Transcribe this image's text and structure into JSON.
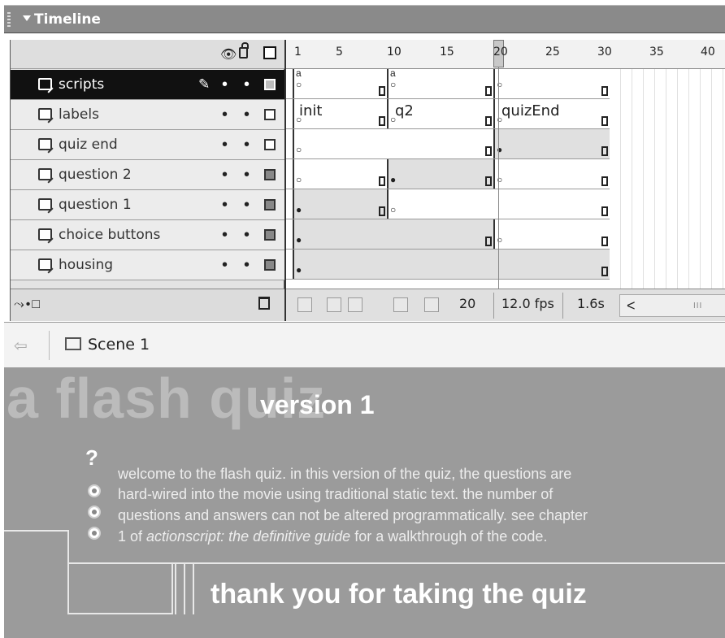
{
  "timeline": {
    "title": "Timeline",
    "header_eye_icon": "eye-icon",
    "header_lock_icon": "lock-icon",
    "header_outline_icon": "outline-icon",
    "ruler_ticks": [
      "1",
      "5",
      "10",
      "15",
      "20",
      "25",
      "30",
      "35",
      "40"
    ],
    "layers": [
      {
        "name": "scripts",
        "selected": true,
        "outline": "filled"
      },
      {
        "name": "labels",
        "selected": false,
        "outline": "empty"
      },
      {
        "name": "quiz end",
        "selected": false,
        "outline": "empty"
      },
      {
        "name": "question 2",
        "selected": false,
        "outline": "filled"
      },
      {
        "name": "question 1",
        "selected": false,
        "outline": "filled"
      },
      {
        "name": "choice buttons",
        "selected": false,
        "outline": "filled"
      },
      {
        "name": "housing",
        "selected": false,
        "outline": "filled"
      }
    ],
    "frame_labels": {
      "init": "init",
      "q2": "q2",
      "quizEnd": "quizEnd"
    },
    "action_marker": "a",
    "visibility_dot": "•",
    "footer": {
      "current_frame": "20",
      "fps": "12.0 fps",
      "elapsed": "1.6s",
      "scroll_left": "<",
      "scroll_thumb": "III"
    }
  },
  "scene_bar": {
    "back_icon": "back-arrow-icon",
    "scene_icon": "clapperboard-icon",
    "scene_label": "Scene 1"
  },
  "stage": {
    "title": "a flash quiz",
    "version": "version 1",
    "question_mark": "?",
    "intro_lines": [
      "welcome to the flash quiz. in this version of the quiz, the questions are",
      "hard-wired into the movie using traditional static text. the number of",
      "questions and answers can not be altered programmatically.  see chapter"
    ],
    "intro_last_prefix": "1 of ",
    "intro_last_italic": "actionscript: the definitive guide",
    "intro_last_suffix": " for a walkthrough of the code.",
    "thank_you": "thank you for taking the quiz"
  }
}
